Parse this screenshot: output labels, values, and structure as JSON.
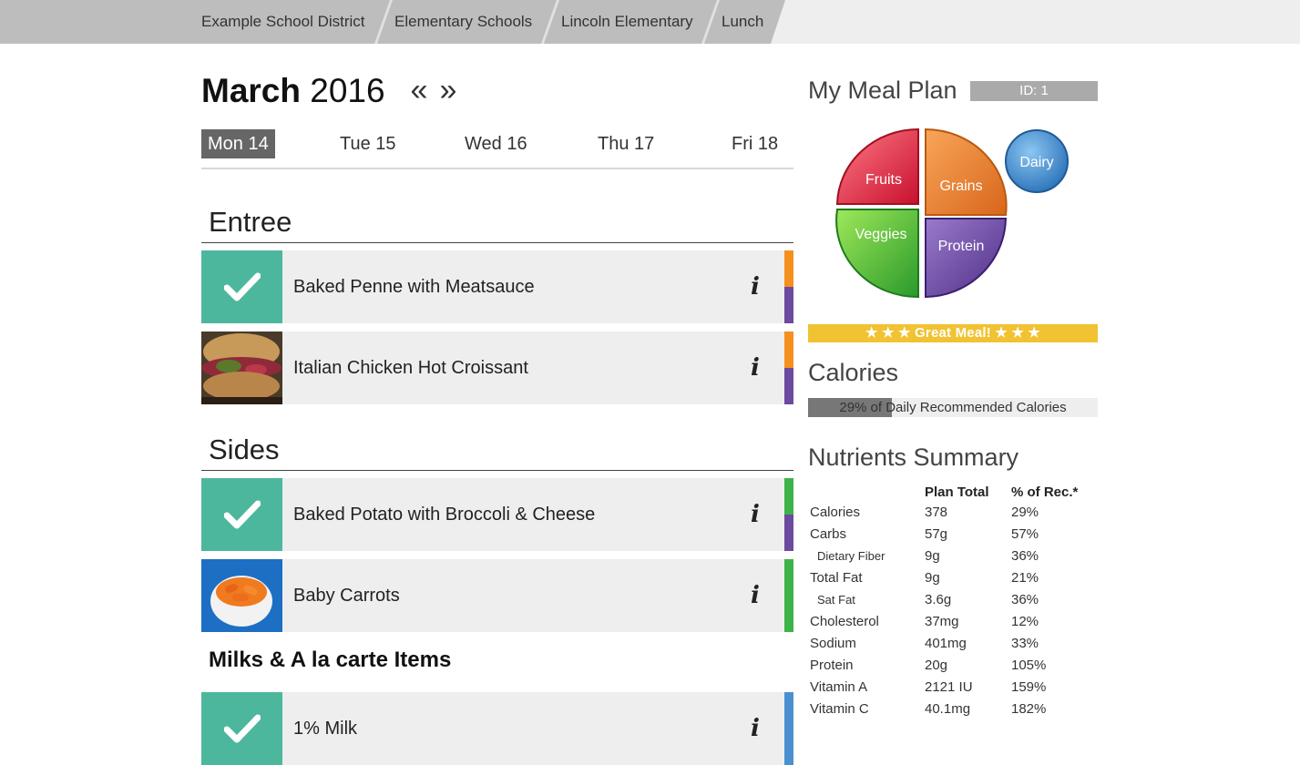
{
  "breadcrumb": [
    "Example School District",
    "Elementary Schools",
    "Lincoln Elementary",
    "Lunch"
  ],
  "month": {
    "name": "March",
    "year": "2016"
  },
  "nav": {
    "prev": "«",
    "next": "»"
  },
  "days": [
    {
      "label": "Mon 14",
      "active": true
    },
    {
      "label": "Tue 15",
      "active": false
    },
    {
      "label": "Wed 16",
      "active": false
    },
    {
      "label": "Thu 17",
      "active": false
    },
    {
      "label": "Fri 18",
      "active": false
    }
  ],
  "sections": {
    "entree": "Entree",
    "sides": "Sides",
    "milks": "Milks & A la carte Items"
  },
  "items": [
    {
      "name": "Baked Penne with Meatsauce",
      "selected": true,
      "stripes": [
        "#f5901e",
        "#6b4aa0"
      ]
    },
    {
      "name": "Italian Chicken Hot Croissant",
      "selected": false,
      "stripes": [
        "#f5901e",
        "#6b4aa0"
      ]
    },
    {
      "name": "Baked Potato with Broccoli & Cheese",
      "selected": true,
      "stripes": [
        "#3cb44a",
        "#6b4aa0"
      ]
    },
    {
      "name": "Baby Carrots",
      "selected": false,
      "stripes": [
        "#3cb44a"
      ]
    },
    {
      "name": "1% Milk",
      "selected": true,
      "stripes": [
        "#4a90d0"
      ]
    }
  ],
  "info_glyph": "i",
  "plan": {
    "title": "My Meal Plan",
    "id_label": "ID: 1",
    "plate": {
      "fruits": "Fruits",
      "grains": "Grains",
      "veggies": "Veggies",
      "protein": "Protein",
      "dairy": "Dairy"
    },
    "great_meal": "★ ★ ★ Great Meal! ★ ★ ★",
    "colors": {
      "fruits": "#d8202f",
      "grains": "#e77a22",
      "veggies": "#3dae3c",
      "protein": "#6a4a9e",
      "dairy": "#3a86c8",
      "banner": "#f1c232"
    }
  },
  "calories": {
    "title": "Calories",
    "text": "29% of Daily Recommended Calories",
    "percent": 29
  },
  "nutrients": {
    "title": "Nutrients Summary",
    "headers": [
      "Plan Total",
      "% of Rec.*"
    ],
    "rows": [
      {
        "name": "Calories",
        "total": "378",
        "pct": "29%"
      },
      {
        "name": "Carbs",
        "total": "57g",
        "pct": "57%"
      },
      {
        "name": "Dietary Fiber",
        "total": "9g",
        "pct": "36%",
        "sub": true
      },
      {
        "name": "Total Fat",
        "total": "9g",
        "pct": "21%"
      },
      {
        "name": "Sat Fat",
        "total": "3.6g",
        "pct": "36%",
        "sub": true
      },
      {
        "name": "Cholesterol",
        "total": "37mg",
        "pct": "12%"
      },
      {
        "name": "Sodium",
        "total": "401mg",
        "pct": "33%"
      },
      {
        "name": "Protein",
        "total": "20g",
        "pct": "105%"
      },
      {
        "name": "Vitamin A",
        "total": "2121 IU",
        "pct": "159%"
      },
      {
        "name": "Vitamin C",
        "total": "40.1mg",
        "pct": "182%"
      }
    ]
  }
}
